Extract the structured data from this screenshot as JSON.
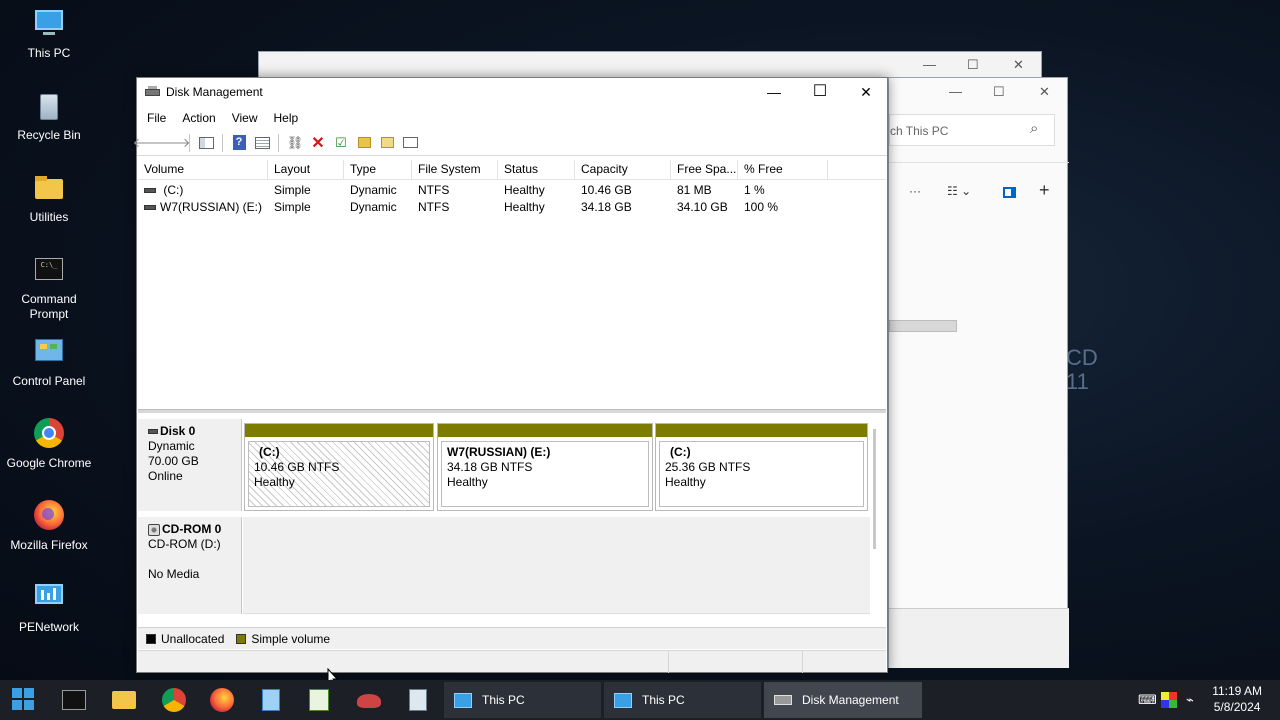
{
  "desktop": {
    "icons": [
      {
        "label": "This PC",
        "icon": "this-pc-icon"
      },
      {
        "label": "Recycle Bin",
        "icon": "recycle-bin-icon"
      },
      {
        "label": "Utilities",
        "icon": "folder-icon"
      },
      {
        "label": "Command Prompt",
        "icon": "command-prompt-icon"
      },
      {
        "label": "Control Panel",
        "icon": "control-panel-icon"
      },
      {
        "label": "Google Chrome",
        "icon": "chrome-icon"
      },
      {
        "label": "Mozilla Firefox",
        "icon": "firefox-icon"
      },
      {
        "label": "PENetwork",
        "icon": "network-icon"
      }
    ],
    "wallpaper_text": {
      "line1": "CD",
      "line2": "11"
    }
  },
  "background_window": {
    "search_placeholder": "ch This PC"
  },
  "window": {
    "title": "Disk Management",
    "controls": {
      "minimize": "—",
      "maximize": "☐",
      "close": "✕"
    }
  },
  "menu": {
    "file": "File",
    "action": "Action",
    "view": "View",
    "help": "Help"
  },
  "volume_list": {
    "columns": [
      "Volume",
      "Layout",
      "Type",
      "File System",
      "Status",
      "Capacity",
      "Free Spa...",
      "% Free"
    ],
    "rows": [
      {
        "volume": " (C:)",
        "layout": "Simple",
        "type": "Dynamic",
        "fs": "NTFS",
        "status": "Healthy",
        "capacity": "10.46 GB",
        "free": "81 MB",
        "pct": "1 %"
      },
      {
        "volume": "W7(RUSSIAN) (E:)",
        "layout": "Simple",
        "type": "Dynamic",
        "fs": "NTFS",
        "status": "Healthy",
        "capacity": "34.18 GB",
        "free": "34.10 GB",
        "pct": "100 %"
      }
    ]
  },
  "disks": {
    "disk0": {
      "name": "Disk 0",
      "type": "Dynamic",
      "size": "70.00 GB",
      "state": "Online"
    },
    "partitions": [
      {
        "name": "(C:)",
        "size": "10.46 GB NTFS",
        "status": "Healthy"
      },
      {
        "name": "W7(RUSSIAN)  (E:)",
        "size": "34.18 GB NTFS",
        "status": "Healthy"
      },
      {
        "name": "(C:)",
        "size": "25.36 GB NTFS",
        "status": "Healthy"
      }
    ],
    "cdrom": {
      "name": "CD-ROM 0",
      "drive": "CD-ROM (D:)",
      "media": "No Media"
    }
  },
  "legend": {
    "unallocated": "Unallocated",
    "simple": "Simple volume",
    "unallocated_color": "#000000",
    "simple_color": "#7c7c00"
  },
  "taskbar": {
    "tasks": [
      {
        "label": "This PC"
      },
      {
        "label": "This PC"
      },
      {
        "label": "Disk Management"
      }
    ],
    "time": "11:19 AM",
    "date": "5/8/2024"
  }
}
